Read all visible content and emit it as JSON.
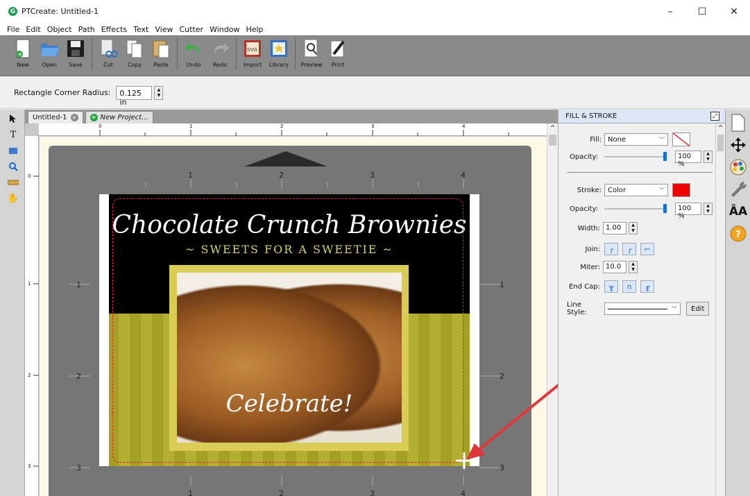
{
  "window": {
    "title": "PTCreate: Untitled-1",
    "minimize": "–",
    "maximize": "☐",
    "close": "✕"
  },
  "menu": [
    "File",
    "Edit",
    "Object",
    "Path",
    "Effects",
    "Text",
    "View",
    "Cutter",
    "Window",
    "Help"
  ],
  "toolbar": {
    "new": "New",
    "open": "Open",
    "save": "Save",
    "cut": "Cut",
    "copy": "Copy",
    "paste": "Paste",
    "undo": "Undo",
    "redo": "Redo",
    "import": "Import",
    "library": "Library",
    "preview": "Preview",
    "print": "Print"
  },
  "options": {
    "corner_radius_label": "Rectangle Corner Radius:",
    "corner_radius_value": "0.125 in"
  },
  "tabs": {
    "document": "Untitled-1",
    "new_project": "New Project..."
  },
  "rulers": {
    "top": [
      "0",
      "1",
      "2",
      "3",
      "4"
    ],
    "left": [
      "0",
      "1",
      "2",
      "3"
    ],
    "mat_top": [
      "1",
      "2",
      "3",
      "4"
    ],
    "mat_side": [
      "1",
      "2",
      "3"
    ]
  },
  "design": {
    "title": "Chocolate Crunch Brownies",
    "subtitle": "~ SWEETS FOR A SWEETIE ~",
    "caption": "Celebrate!"
  },
  "panel": {
    "header": "FILL & STROKE",
    "fill_label": "Fill:",
    "fill_value": "None",
    "opacity_label": "Opacity:",
    "fill_opacity": "100 %",
    "stroke_label": "Stroke:",
    "stroke_value": "Color",
    "stroke_color": "#ee0000",
    "stroke_opacity": "100 %",
    "width_label": "Width:",
    "width_value": "1.00",
    "join_label": "Join:",
    "miter_label": "Miter:",
    "miter_value": "10.0",
    "endcap_label": "End Cap:",
    "linestyle_label": "Line Style:",
    "edit_button": "Edit"
  }
}
